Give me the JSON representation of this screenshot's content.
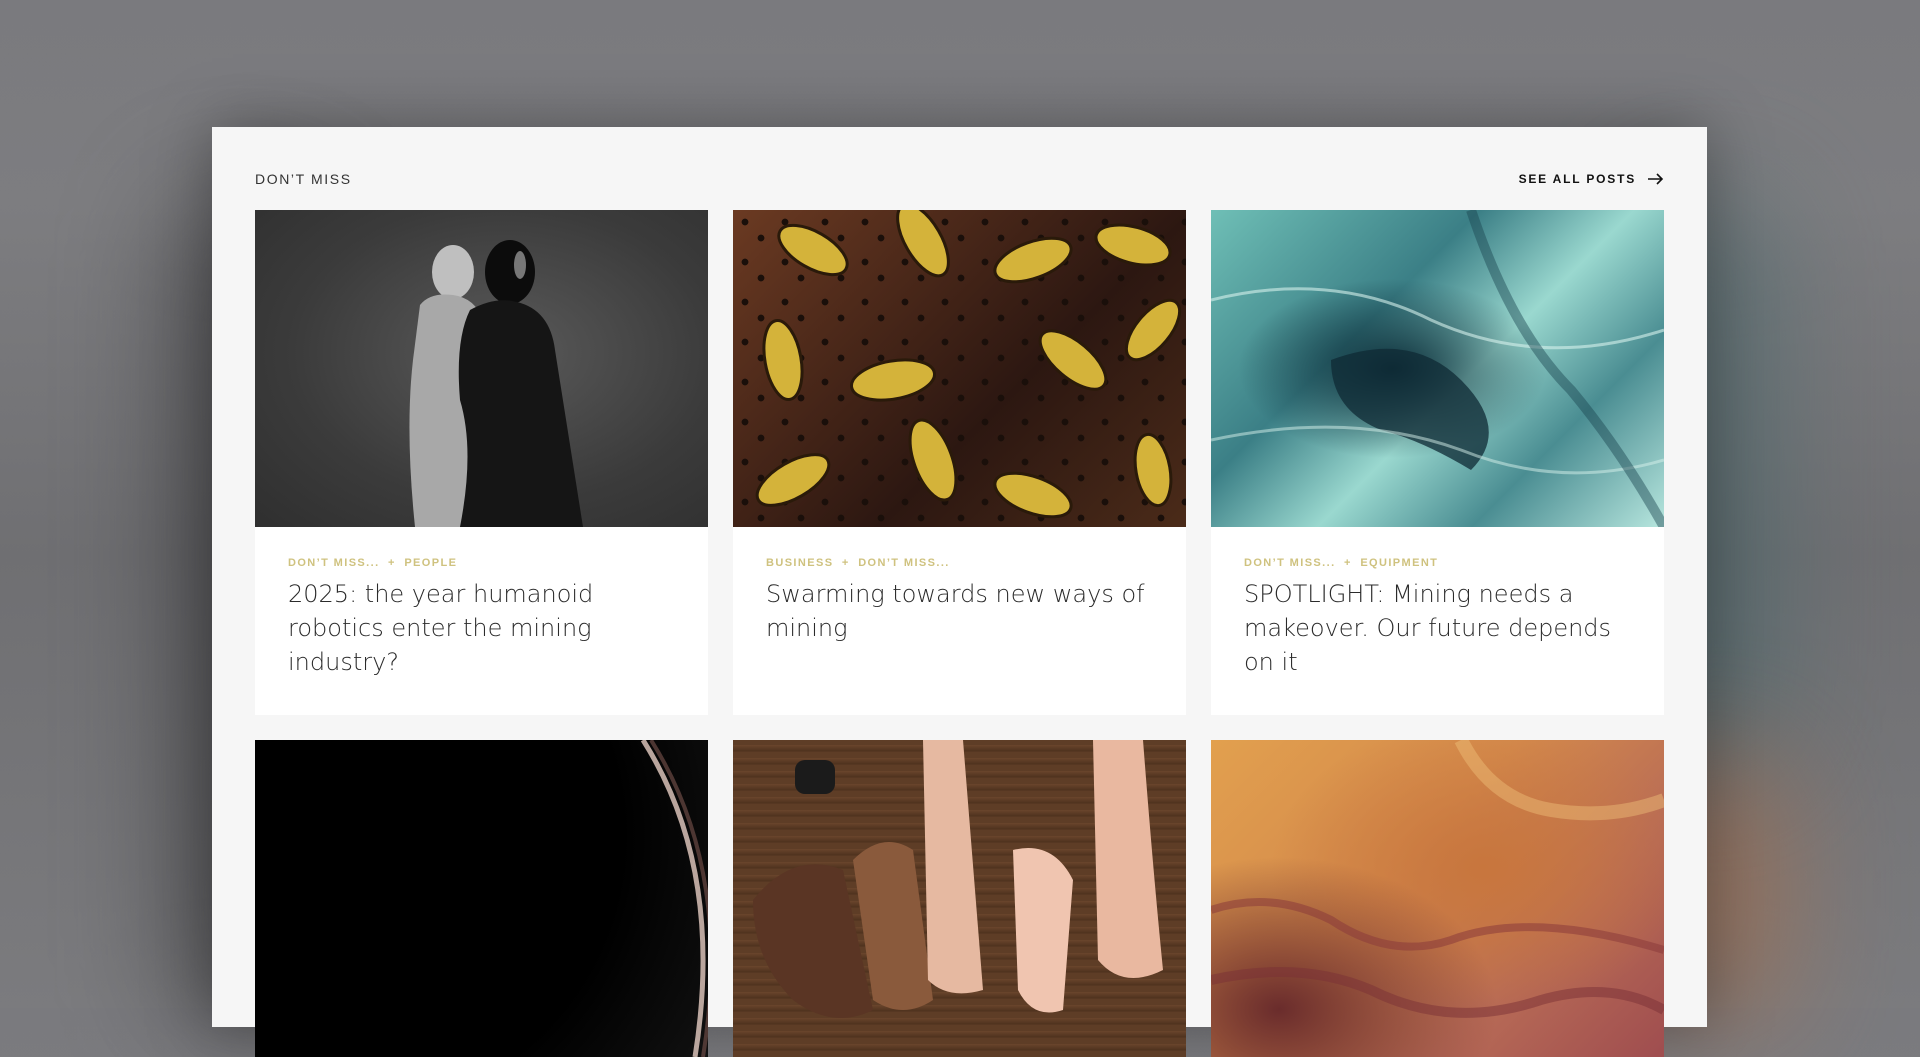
{
  "section": {
    "title": "DON’T MISS",
    "see_all_label": "SEE ALL POSTS"
  },
  "posts": [
    {
      "image_icon": "robots-photo",
      "category1": "DON’T MISS...",
      "separator": "+",
      "category2": "PEOPLE",
      "title": "2025: the year humanoid robotics enter the mining industry?"
    },
    {
      "image_icon": "bees-photo",
      "category1": "BUSINESS",
      "separator": "+",
      "category2": "DON’T MISS...",
      "title": "Swarming towards new ways of mining"
    },
    {
      "image_icon": "glacier-photo",
      "category1": "DON’T MISS...",
      "separator": "+",
      "category2": "EQUIPMENT",
      "title": "SPOTLIGHT: Mining needs a makeover. Our future depends on it"
    },
    {
      "image_icon": "planet-photo"
    },
    {
      "image_icon": "hands-photo"
    },
    {
      "image_icon": "desert-photo"
    }
  ],
  "colors": {
    "category": "#cfc27f",
    "title": "#2b2b2b",
    "panel": "#f6f6f6"
  }
}
